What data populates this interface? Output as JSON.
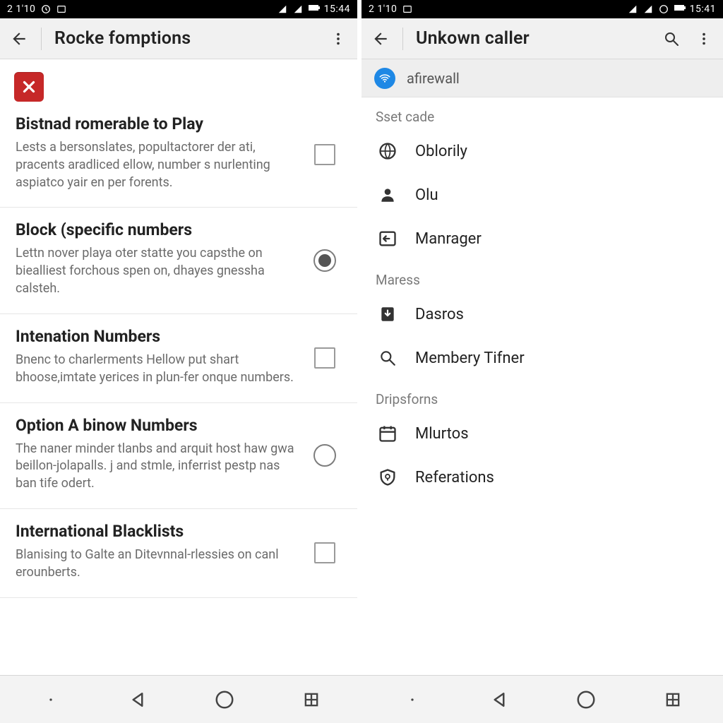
{
  "left": {
    "status": {
      "time": "2 1'10",
      "clock": "15:44"
    },
    "appbar": {
      "title": "Rocke fomptions"
    },
    "settings": [
      {
        "label": "Bistnad romerable to Play",
        "desc": "Lests a bersonslates, popultactorer der ati, pracents aradliced ellow, number s nurlenting aspiatco yair en per forents.",
        "control": "checkbox",
        "checked": false
      },
      {
        "label": "Block (specific numbers",
        "desc": "Lettn nover playa oter statte you capsthe on biealliest forchous spen on, dhayes gnessha calsteh.",
        "control": "radio",
        "checked": true
      },
      {
        "label": "Intenation Numbers",
        "desc": "Bnenc to charlerments Hellow put shart bhoose,imtate yerices in plun-fer onque numbers.",
        "control": "checkbox",
        "checked": false
      },
      {
        "label": "Option A binow Numbers",
        "desc": "The naner minder tlanbs and arquit host haw gwa beillon-jolapalls. j and stmle, inferrist pestp nas ban tife odert.",
        "control": "radio",
        "checked": false
      },
      {
        "label": "International Blacklists",
        "desc": "Blanising to Galte an Ditevnnal-rlessies on canl erounberts.",
        "control": "checkbox",
        "checked": false
      }
    ]
  },
  "right": {
    "status": {
      "time": "2 1'10",
      "clock": "15:41"
    },
    "appbar": {
      "title": "Unkown caller"
    },
    "banner": {
      "text": "afirewall"
    },
    "sections": [
      {
        "header": "Sset cade",
        "items": [
          {
            "icon": "globe-icon",
            "label": "Oblorily"
          },
          {
            "icon": "person-icon",
            "label": "Olu"
          },
          {
            "icon": "inbox-arrow-icon",
            "label": "Manrager"
          }
        ]
      },
      {
        "header": "Maress",
        "items": [
          {
            "icon": "download-badge-icon",
            "label": "Dasros"
          },
          {
            "icon": "search-icon",
            "label": "Membery Tifner"
          }
        ]
      },
      {
        "header": "Dripsforns",
        "items": [
          {
            "icon": "calendar-icon",
            "label": "Mlurtos"
          },
          {
            "icon": "shield-icon",
            "label": "Referations"
          }
        ]
      }
    ]
  }
}
